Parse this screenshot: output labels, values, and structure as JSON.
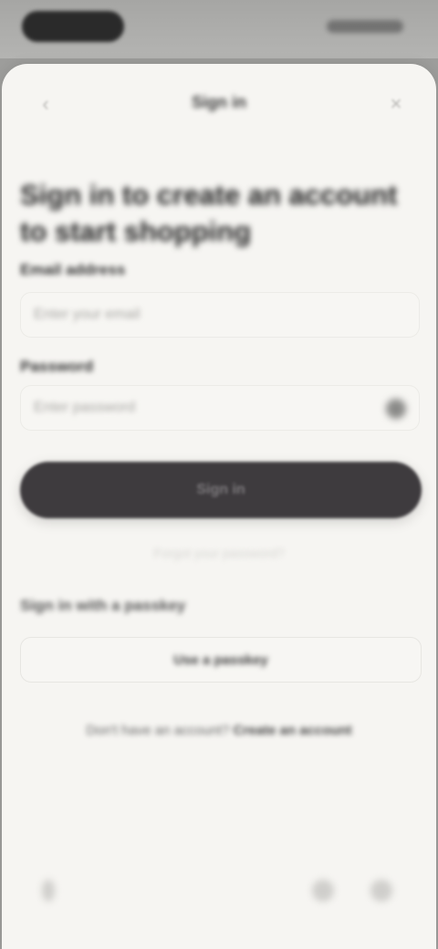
{
  "screen": {
    "title": "Sign in",
    "heading": "Sign in to create an account to start shopping",
    "colors": {
      "background": "#f6f5f2",
      "primary_button": "#3e3b3e",
      "backdrop": "#9d9d9b"
    }
  },
  "header": {
    "back_icon": "chevron-left-icon",
    "close_icon": "close-icon"
  },
  "form": {
    "email_label": "Email address",
    "email_placeholder": "Enter your email",
    "password_label": "Password",
    "password_placeholder": "Enter password",
    "password_toggle_icon": "eye-icon",
    "submit_label": "Sign in",
    "forgot_link": "Forgot your password?"
  },
  "alternative": {
    "section_title": "Sign in with a passkey",
    "passkey_button": "Use a passkey"
  },
  "footer": {
    "prompt": "Don't have an account?",
    "link": "Create an account"
  },
  "browser_nav": {
    "icons": [
      "back-icon",
      "share-icon",
      "more-icon"
    ]
  }
}
